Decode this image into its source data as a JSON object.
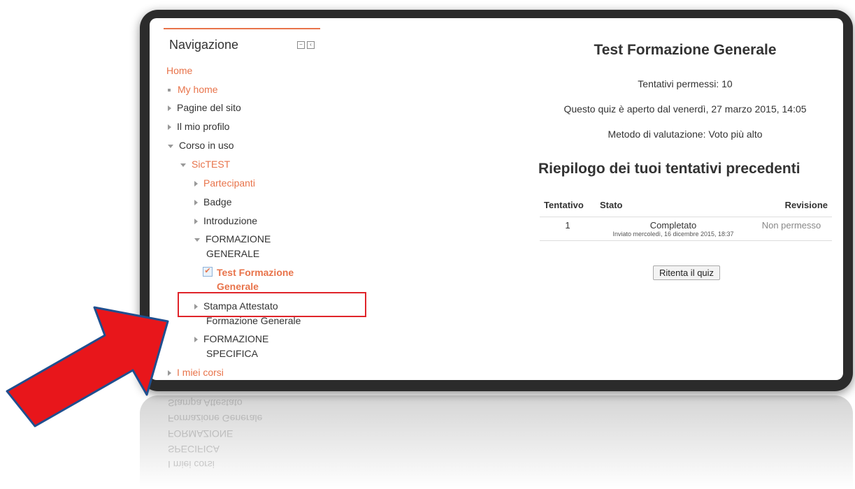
{
  "navigation": {
    "title": "Navigazione",
    "items": [
      {
        "label": "Home"
      },
      {
        "label": "My home"
      },
      {
        "label": "Pagine del sito"
      },
      {
        "label": "Il mio profilo"
      },
      {
        "label": "Corso in uso"
      },
      {
        "label": "SicTEST"
      },
      {
        "label": "Partecipanti"
      },
      {
        "label": "Badge"
      },
      {
        "label": "Introduzione"
      },
      {
        "label": "FORMAZIONE"
      },
      {
        "label": "GENERALE"
      },
      {
        "label": "Test Formazione"
      },
      {
        "label": "Generale"
      },
      {
        "label": "Stampa Attestato"
      },
      {
        "label": "Formazione Generale"
      },
      {
        "label": "FORMAZIONE"
      },
      {
        "label": "SPECIFICA"
      },
      {
        "label": "I miei corsi"
      }
    ]
  },
  "quiz": {
    "title": "Test Formazione Generale",
    "attempts_allowed": "Tentativi permessi: 10",
    "open_since": "Questo quiz è aperto dal venerdì, 27 marzo 2015, 14:05",
    "grading_method": "Metodo di valutazione: Voto più alto",
    "summary_title": "Riepilogo dei tuoi tentativi precedenti",
    "table": {
      "headers": [
        "Tentativo",
        "Stato",
        "Revisione"
      ],
      "rows": [
        {
          "attempt": "1",
          "status": "Completato",
          "submitted": "Inviato mercoledì, 16 dicembre 2015, 18:37",
          "review": "Non permesso"
        }
      ]
    },
    "retake_button": "Ritenta il quiz"
  },
  "colors": {
    "accent": "#e8734a",
    "highlight": "#e0242a",
    "arrow": "#e8161b",
    "arrow_outline": "#1f4f8f"
  }
}
